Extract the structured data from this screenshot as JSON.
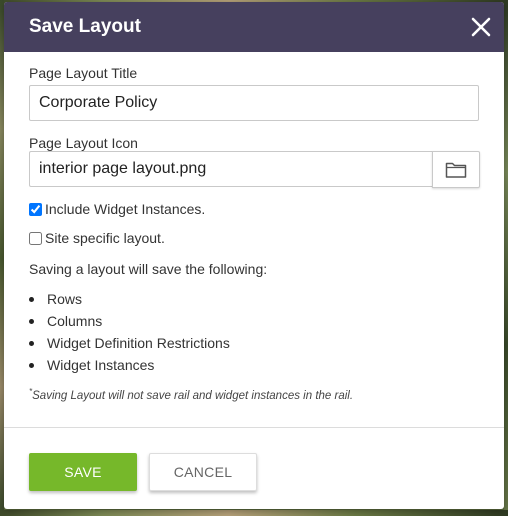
{
  "dialog": {
    "title": "Save Layout",
    "close_icon": "close-icon"
  },
  "form": {
    "title_label": "Page Layout Title",
    "title_value": "Corporate Policy",
    "icon_label": "Page Layout Icon",
    "icon_value": "interior page layout.png",
    "browse_icon": "folder-icon",
    "include_widgets_label": "Include Widget Instances.",
    "include_widgets_checked": true,
    "site_specific_label": "Site specific layout.",
    "site_specific_checked": false
  },
  "info": {
    "intro": "Saving a layout will save the following:",
    "items": [
      "Rows",
      "Columns",
      "Widget Definition Restrictions",
      "Widget Instances"
    ],
    "footnote_mark": "*",
    "footnote": "Saving Layout will not save rail and widget instances in the rail."
  },
  "footer": {
    "save_label": "SAVE",
    "cancel_label": "CANCEL"
  },
  "colors": {
    "header_bg": "#46405e",
    "save_bg": "#76b82a"
  }
}
